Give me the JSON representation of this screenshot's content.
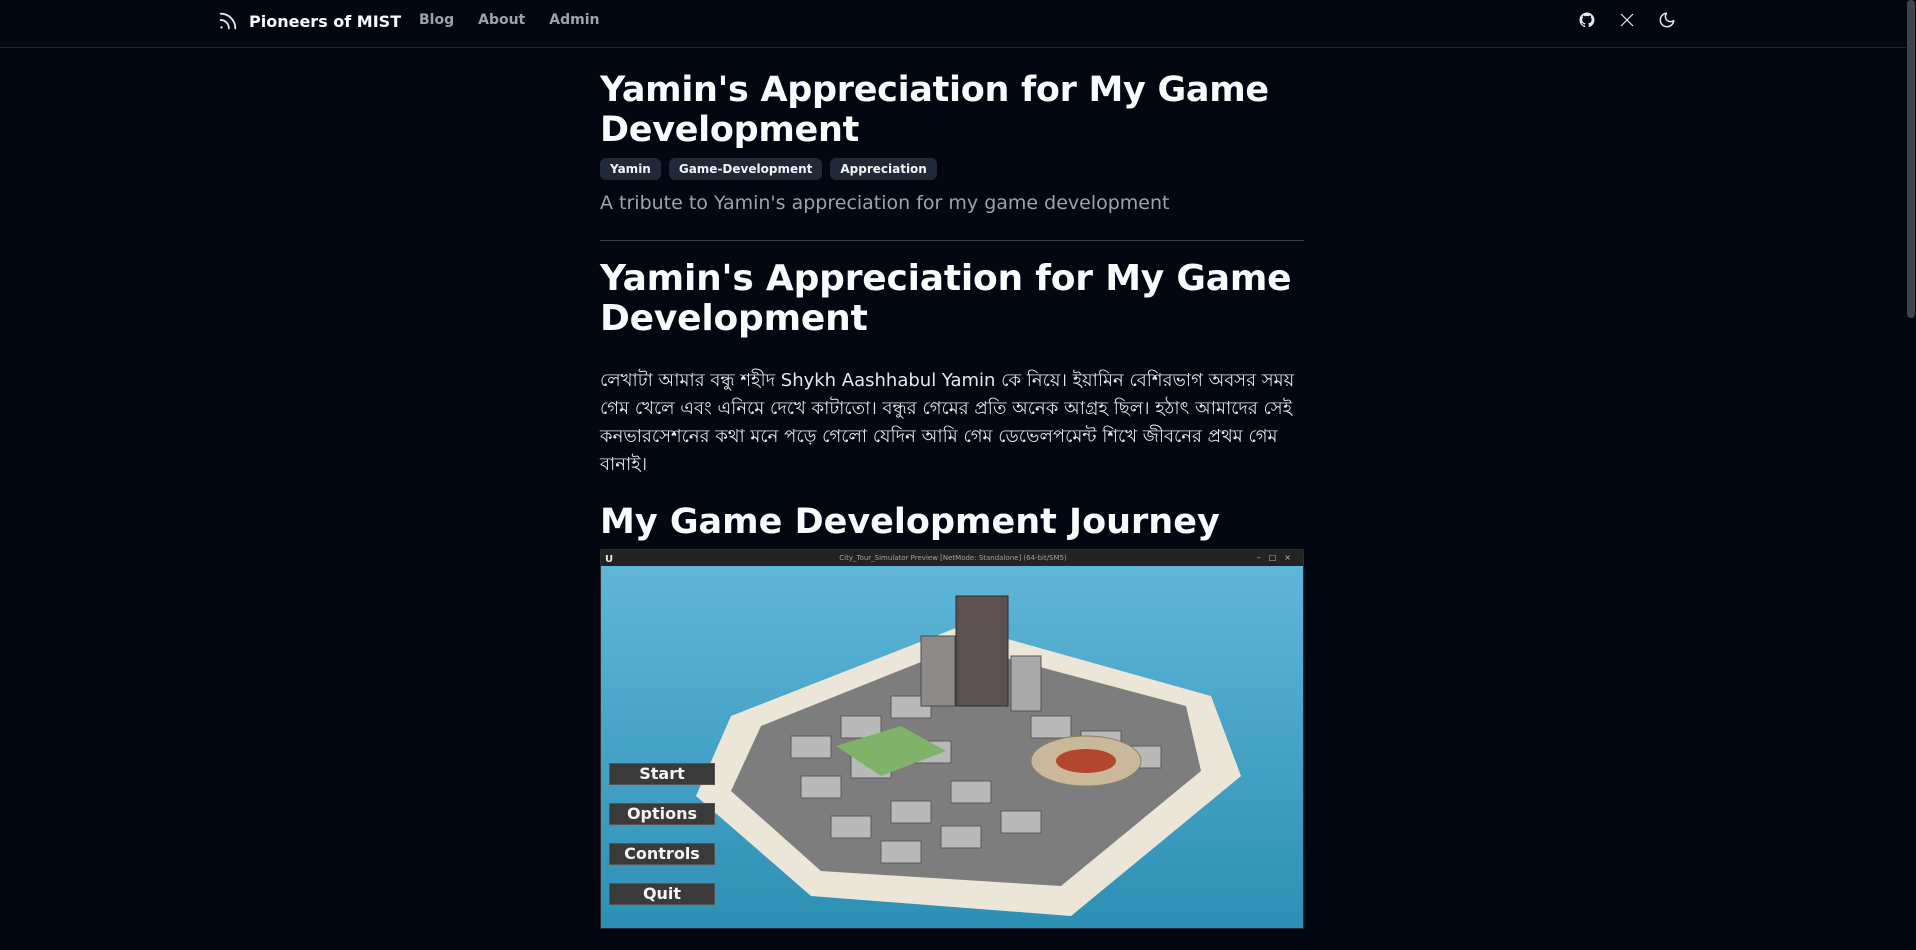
{
  "nav": {
    "brand": "Pioneers of MIST",
    "links": [
      "Blog",
      "About",
      "Admin"
    ],
    "icons": [
      "rss-icon",
      "github-icon",
      "x-icon",
      "moon-icon"
    ]
  },
  "article": {
    "title": "Yamin's Appreciation for My Game Development",
    "tags": [
      "Yamin",
      "Game-Development",
      "Appreciation"
    ],
    "summary": "A tribute to Yamin's appreciation for my game development",
    "heading1": "Yamin's Appreciation for My Game Development",
    "paragraph": "লেখাটা আমার বন্ধু শহীদ Shykh Aashhabul Yamin কে নিয়ে। ইয়ামিন বেশিরভাগ অবসর সময় গেম খেলে এবং এনিমে দেখে কাটাতো। বন্ধুর গেমের প্রতি অনেক আগ্রহ ছিল। হঠাৎ আমাদের সেই কনভারসেশনের কথা মনে পড়ে গেলো যেদিন আমি গেম ডেভেলপমেন্ট শিখে জীবনের প্রথম গেম বানাই।",
    "heading2": "My Game Development Journey"
  },
  "screenshot": {
    "window_title": "City_Tour_Simulator Preview [NetMode: Standalone] (64-bit/SM5)",
    "menu": [
      "Start",
      "Options",
      "Controls",
      "Quit"
    ]
  },
  "colors": {
    "background": "#030712",
    "text": "#f9fafb",
    "muted": "#9ca3af",
    "tag_bg": "#1f2937"
  }
}
